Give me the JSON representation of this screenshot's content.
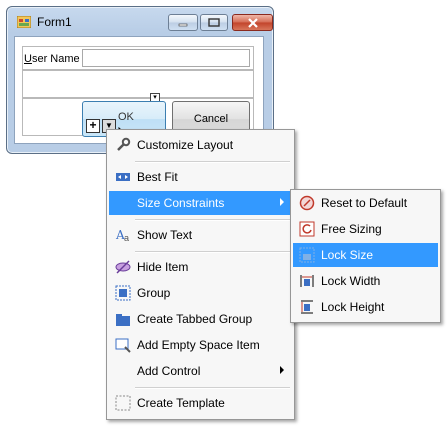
{
  "window": {
    "title": "Form1"
  },
  "form": {
    "user_label_prefix": "U",
    "user_label_rest": "ser Name",
    "ok_label": "OK",
    "cancel_label": "Cancel"
  },
  "context_menu": {
    "items": [
      {
        "label": "Customize Layout",
        "icon": "wrench-icon"
      },
      {
        "label": "Best Fit",
        "icon": "best-fit-icon"
      },
      {
        "label": "Size Constraints",
        "icon": "",
        "submenu": true
      },
      {
        "label": "Show Text",
        "icon": "text-icon"
      },
      {
        "label": "Hide Item",
        "icon": "hide-icon"
      },
      {
        "label": "Group",
        "icon": "group-icon"
      },
      {
        "label": "Create Tabbed Group",
        "icon": "tabbed-group-icon"
      },
      {
        "label": "Add Empty Space Item",
        "icon": "empty-space-icon"
      },
      {
        "label": "Add Control",
        "icon": "",
        "submenu": true
      },
      {
        "label": "Create Template",
        "icon": "template-icon"
      }
    ]
  },
  "submenu": {
    "items": [
      {
        "label": "Reset to Default",
        "icon": "reset-icon"
      },
      {
        "label": "Free Sizing",
        "icon": "free-sizing-icon"
      },
      {
        "label": "Lock Size",
        "icon": "lock-size-icon"
      },
      {
        "label": "Lock Width",
        "icon": "lock-width-icon"
      },
      {
        "label": "Lock Height",
        "icon": "lock-height-icon"
      }
    ]
  },
  "colors": {
    "highlight": "#3399ff",
    "menu_bg": "#f7f7f7"
  }
}
